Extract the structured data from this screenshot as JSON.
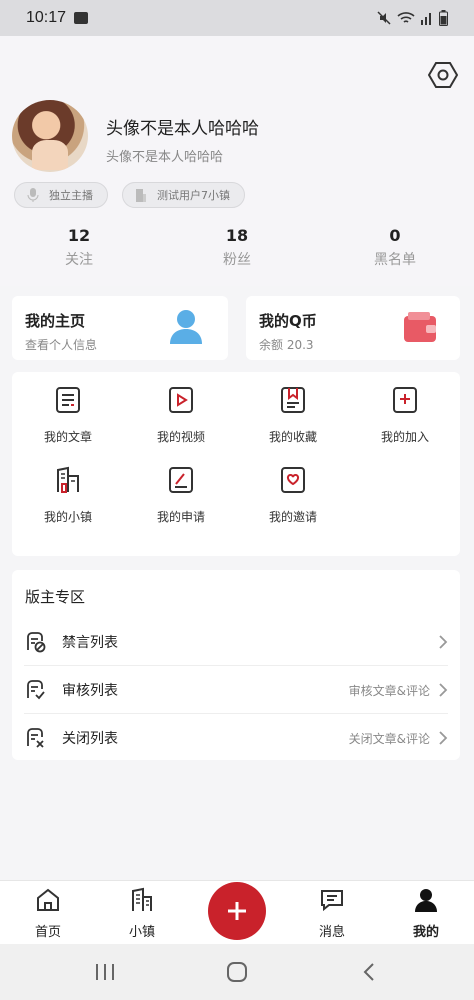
{
  "status": {
    "time": "10:17"
  },
  "profile": {
    "name": "头像不是本人哈哈哈",
    "subtitle": "头像不是本人哈哈哈",
    "tags": [
      "独立主播",
      "测试用户7小镇"
    ]
  },
  "stats": [
    {
      "value": "12",
      "label": "关注"
    },
    {
      "value": "18",
      "label": "粉丝"
    },
    {
      "value": "0",
      "label": "黑名单"
    }
  ],
  "cards": {
    "home": {
      "title": "我的主页",
      "sub": "查看个人信息"
    },
    "coins": {
      "title": "我的Q币",
      "sub": "余额 20.3"
    }
  },
  "grid": [
    {
      "label": "我的文章",
      "icon": "article-icon"
    },
    {
      "label": "我的视频",
      "icon": "video-icon"
    },
    {
      "label": "我的收藏",
      "icon": "bookmark-icon"
    },
    {
      "label": "我的加入",
      "icon": "join-icon"
    },
    {
      "label": "我的小镇",
      "icon": "town-icon"
    },
    {
      "label": "我的申请",
      "icon": "apply-icon"
    },
    {
      "label": "我的邀请",
      "icon": "invite-icon"
    }
  ],
  "moderator": {
    "title": "版主专区",
    "rows": [
      {
        "label": "禁言列表",
        "note": ""
      },
      {
        "label": "审核列表",
        "note": "审核文章&评论"
      },
      {
        "label": "关闭列表",
        "note": "关闭文章&评论"
      }
    ]
  },
  "tabs": [
    {
      "label": "首页"
    },
    {
      "label": "小镇"
    },
    {
      "label": "消息"
    },
    {
      "label": "我的"
    }
  ],
  "colors": {
    "accent": "#c9222b",
    "coin": "#e85a65",
    "avatar_blue": "#5aaee6"
  }
}
